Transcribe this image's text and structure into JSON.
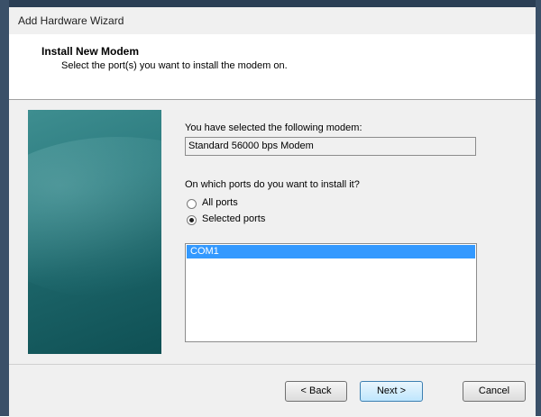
{
  "window": {
    "title": "Add Hardware Wizard"
  },
  "header": {
    "title": "Install New Modem",
    "subtitle": "Select the port(s) you want to install the modem on."
  },
  "content": {
    "selected_modem_label": "You have selected the following modem:",
    "selected_modem_value": "Standard 56000 bps Modem",
    "ports_question": "On which ports do you want to install it?",
    "radio_all_ports": {
      "label": "All ports",
      "checked": false
    },
    "radio_selected_ports": {
      "label": "Selected ports",
      "checked": true
    },
    "ports": [
      {
        "name": "COM1",
        "selected": true
      }
    ]
  },
  "footer": {
    "back_label": "< Back",
    "next_label": "Next >",
    "cancel_label": "Cancel"
  },
  "colors": {
    "selection": "#3399ff",
    "watermark": "#1b6367",
    "dialog_bg": "#f0f0f0"
  }
}
